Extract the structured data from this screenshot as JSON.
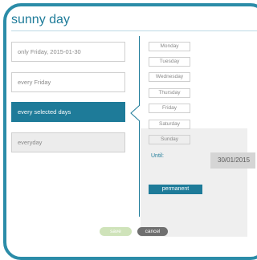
{
  "dialog": {
    "title": "sunny day"
  },
  "options": [
    {
      "label": "only Friday, 2015-01-30"
    },
    {
      "label": "every Friday"
    },
    {
      "label": "every selected days"
    },
    {
      "label": "everyday"
    }
  ],
  "days": [
    "Monday",
    "Tuesday",
    "Wednesday",
    "Thursday",
    "Friday",
    "Saturday",
    "Sunday"
  ],
  "until": {
    "label": "Until:",
    "date": "30/01/2015"
  },
  "buttons": {
    "permanent": "permanent",
    "save": "save",
    "cancel": "cancel"
  },
  "colors": {
    "accent": "#1e7b99",
    "frame": "#2b8ca8",
    "save_disabled": "#cfe3ba",
    "cancel": "#6f6f6f"
  },
  "state": {
    "selected_option": "every selected days"
  }
}
